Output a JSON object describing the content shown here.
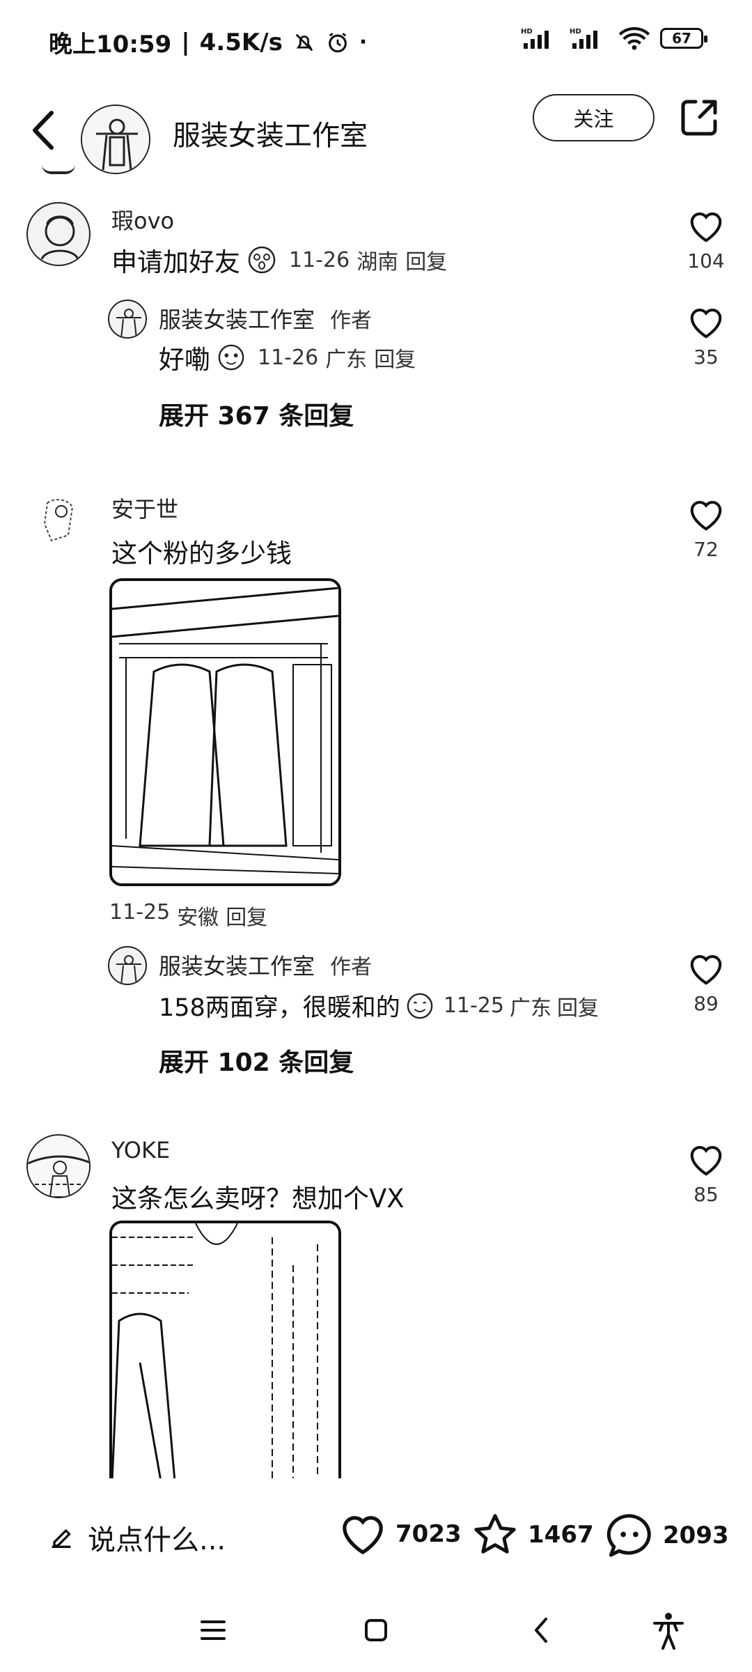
{
  "status_bar": {
    "time": "晚上10:59",
    "speed": "4.5K/s",
    "battery": "67",
    "signal_label": "HD"
  },
  "header": {
    "title": "服装女装工作室",
    "follow_label": "关注"
  },
  "comments": [
    {
      "username": "瑕ovo",
      "text": "申请加好友",
      "date": "11-26",
      "location": "湖南",
      "reply_label": "回复",
      "likes": "104",
      "reply": {
        "username": "服装女装工作室",
        "author_tag": "作者",
        "text": "好嘞",
        "date": "11-26",
        "location": "广东",
        "reply_label": "回复",
        "likes": "35"
      },
      "expand_label": "展开 367 条回复"
    },
    {
      "username": "安于世",
      "text": "这个粉的多少钱",
      "date": "11-25",
      "location": "安徽",
      "reply_label": "回复",
      "likes": "72",
      "reply": {
        "username": "服装女装工作室",
        "author_tag": "作者",
        "text": "158两面穿，很暖和的",
        "date": "11-25",
        "location": "广东",
        "reply_label": "回复",
        "likes": "89"
      },
      "expand_label": "展开 102 条回复"
    },
    {
      "username": "YOKE",
      "text": "这条怎么卖呀？想加个VX",
      "likes": "85"
    }
  ],
  "bottom_bar": {
    "input_placeholder": "说点什么...",
    "likes": "7023",
    "favorites": "1467",
    "comments": "2093"
  },
  "colors": {
    "background": "#ffffff",
    "text": "#111111"
  }
}
